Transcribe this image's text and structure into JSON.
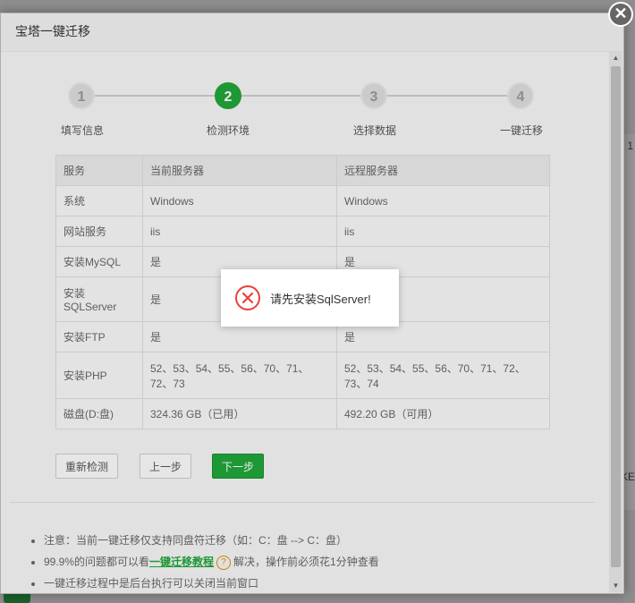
{
  "background": {
    "side_text_1": "1",
    "side_text_ke": "KE"
  },
  "dialog": {
    "title": "宝塔一键迁移",
    "close_label": "✕"
  },
  "stepper": {
    "steps": [
      {
        "number": "1",
        "label": "填写信息",
        "active": false
      },
      {
        "number": "2",
        "label": "检测环境",
        "active": true
      },
      {
        "number": "3",
        "label": "选择数据",
        "active": false
      },
      {
        "number": "4",
        "label": "一键迁移",
        "active": false
      }
    ]
  },
  "table": {
    "headers": [
      "服务",
      "当前服务器",
      "远程服务器"
    ],
    "rows": [
      [
        "系统",
        "Windows",
        "Windows"
      ],
      [
        "网站服务",
        "iis",
        "iis"
      ],
      [
        "安装MySQL",
        "是",
        "是"
      ],
      [
        "安装SQLServer",
        "是",
        ""
      ],
      [
        "安装FTP",
        "是",
        "是"
      ],
      [
        "安装PHP",
        "52、53、54、55、56、70、71、72、73",
        "52、53、54、55、56、70、71、72、73、74"
      ],
      [
        "磁盘(D:盘)",
        "324.36 GB（已用）",
        "492.20 GB（可用）"
      ]
    ]
  },
  "buttons": {
    "recheck": "重新检测",
    "prev": "上一步",
    "next": "下一步"
  },
  "notes": {
    "note1": "注意：当前一键迁移仅支持同盘符迁移（如：C：盘 --> C：盘）",
    "note2_before": "99.9%的问题都可以看",
    "note2_link": "一键迁移教程",
    "note2_after": "解决，操作前必须花1分钟查看",
    "note3": "一键迁移过程中是后台执行可以关闭当前窗口",
    "help_icon": "?"
  },
  "message": {
    "text": "请先安装SqlServer!",
    "icon": "error-circle-icon"
  },
  "colors": {
    "accent": "#20a53a",
    "error": "#e8413d"
  }
}
